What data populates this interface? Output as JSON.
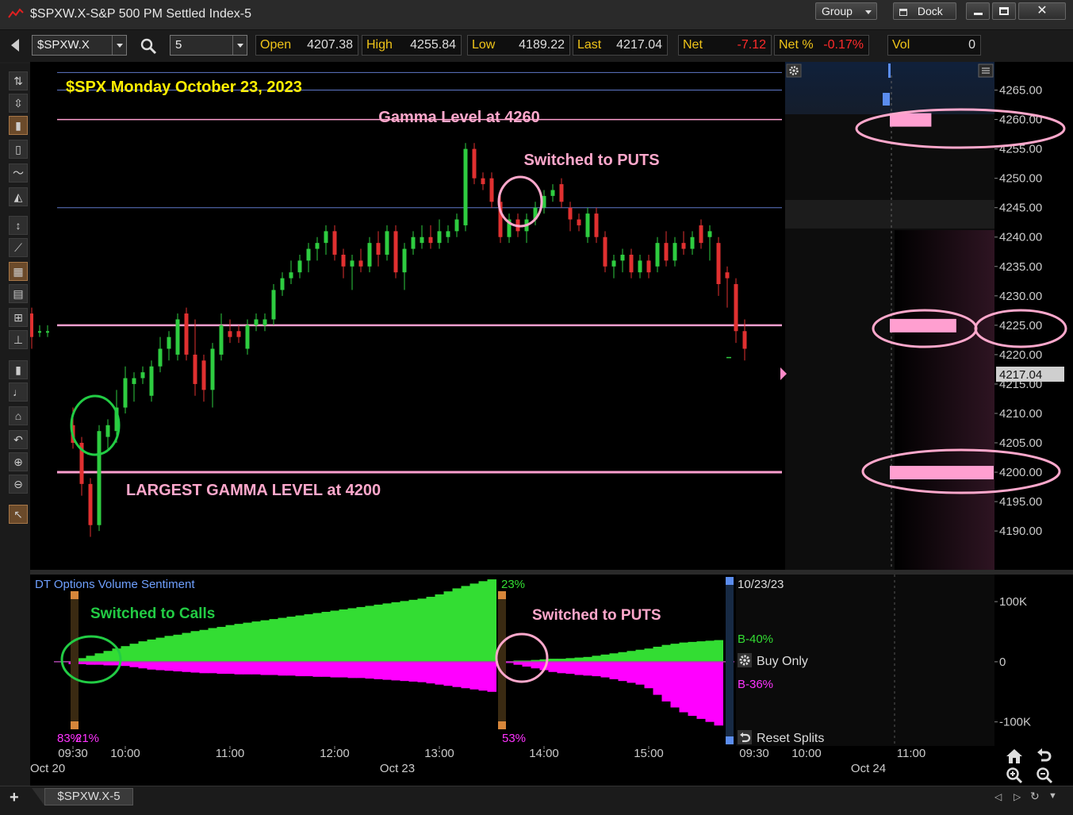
{
  "window": {
    "title": "$SPXW.X-S&P 500 PM Settled Index-5",
    "group_label": "Group",
    "dock_label": "Dock"
  },
  "toolbar": {
    "symbol": "$SPXW.X",
    "interval": "5",
    "quotes": [
      {
        "label": "Open",
        "value": "4207.38",
        "neg": false
      },
      {
        "label": "High",
        "value": "4255.84",
        "neg": false
      },
      {
        "label": "Low",
        "value": "4189.22",
        "neg": false
      },
      {
        "label": "Last",
        "value": "4217.04",
        "neg": false
      },
      {
        "label": "Net",
        "value": "-7.12",
        "neg": true
      },
      {
        "label": "Net %",
        "value": "-0.17%",
        "neg": true
      },
      {
        "label": "Vol",
        "value": "0",
        "neg": false
      }
    ]
  },
  "footer": {
    "tab_label": "$SPXW.X-5"
  },
  "colors": {
    "up": "#2ecc40",
    "down": "#e03030",
    "gamma": "#ff9fd0",
    "annotation_green": "#22cc44",
    "annotation_pink": "#ffa8cc",
    "title_yellow": "#ffee00",
    "calls": "#33dd33",
    "puts": "#ff00ff"
  },
  "chart_data": [
    {
      "type": "candlestick",
      "title": "$SPX Monday October 23, 2023",
      "y_ticks": [
        4190,
        4195,
        4200,
        4205,
        4210,
        4215,
        4220,
        4225,
        4230,
        4235,
        4240,
        4245,
        4250,
        4255,
        4260,
        4265
      ],
      "y_tick_labels": [
        "4190.00",
        "4195.00",
        "4200.00",
        "4205.00",
        "4210.00",
        "4215.00",
        "4220.00",
        "4225.00",
        "4230.00",
        "4235.00",
        "4240.00",
        "4245.00",
        "4250.00",
        "4255.00",
        "4260.00",
        "4265.00"
      ],
      "ylim": [
        4183.4,
        4269.8
      ],
      "x_ticks": [
        "09:30",
        "10:00",
        "11:00",
        "12:00",
        "13:00",
        "14:00",
        "15:00"
      ],
      "x_tick_times": [
        "09:30",
        "10:00",
        "11:00",
        "12:00",
        "13:00",
        "14:00",
        "15:00"
      ],
      "x_extra_labels": [
        "09:30",
        "10:00",
        "11:00"
      ],
      "x_date_labels": [
        "Oct 20",
        "Oct 23",
        "Oct 24"
      ],
      "last_price_label": "4217.04",
      "gamma_levels": [
        {
          "level": 4260,
          "label": "Gamma Level at 4260"
        },
        {
          "level": 4225,
          "label": ""
        },
        {
          "level": 4200,
          "label": "LARGEST GAMMA LEVEL at 4200"
        }
      ],
      "reference_lines": [
        4268,
        4265,
        4245
      ],
      "annotations": [
        "Switched to PUTS"
      ],
      "profile_bars": [
        {
          "level": 4260,
          "size": 0.4
        },
        {
          "level": 4225,
          "size": 0.64
        },
        {
          "level": 4200,
          "size": 1.0
        }
      ],
      "prior_day": [
        {
          "o": 4227,
          "h": 4228,
          "l": 4221,
          "c": 4223
        },
        {
          "o": 4224,
          "h": 4225,
          "l": 4223,
          "c": 4224
        },
        {
          "o": 4224,
          "h": 4225,
          "l": 4223,
          "c": 4224
        }
      ],
      "candles": [
        {
          "t": "09:30",
          "o": 4208,
          "h": 4211,
          "l": 4204,
          "c": 4205
        },
        {
          "t": "09:35",
          "o": 4205,
          "h": 4206,
          "l": 4196,
          "c": 4198
        },
        {
          "t": "09:40",
          "o": 4198,
          "h": 4199,
          "l": 4189,
          "c": 4191
        },
        {
          "t": "09:45",
          "o": 4191,
          "h": 4208,
          "l": 4190,
          "c": 4207
        },
        {
          "t": "09:50",
          "o": 4206,
          "h": 4209,
          "l": 4204,
          "c": 4208
        },
        {
          "t": "09:55",
          "o": 4207,
          "h": 4214,
          "l": 4205,
          "c": 4211
        },
        {
          "t": "10:00",
          "o": 4211,
          "h": 4218,
          "l": 4210,
          "c": 4216
        },
        {
          "t": "10:05",
          "o": 4215,
          "h": 4217,
          "l": 4212,
          "c": 4216
        },
        {
          "t": "10:10",
          "o": 4216,
          "h": 4218,
          "l": 4215,
          "c": 4217
        },
        {
          "t": "10:15",
          "o": 4213,
          "h": 4219,
          "l": 4212,
          "c": 4218
        },
        {
          "t": "10:20",
          "o": 4218,
          "h": 4223,
          "l": 4217,
          "c": 4221
        },
        {
          "t": "10:25",
          "o": 4221,
          "h": 4224,
          "l": 4219,
          "c": 4223
        },
        {
          "t": "10:30",
          "o": 4220,
          "h": 4227,
          "l": 4219,
          "c": 4226
        },
        {
          "t": "10:35",
          "o": 4227,
          "h": 4228,
          "l": 4219,
          "c": 4220
        },
        {
          "t": "10:40",
          "o": 4220,
          "h": 4226,
          "l": 4213,
          "c": 4215
        },
        {
          "t": "10:45",
          "o": 4219,
          "h": 4220,
          "l": 4212,
          "c": 4214
        },
        {
          "t": "10:50",
          "o": 4214,
          "h": 4222,
          "l": 4211,
          "c": 4221
        },
        {
          "t": "10:55",
          "o": 4220,
          "h": 4227,
          "l": 4219,
          "c": 4225
        },
        {
          "t": "11:00",
          "o": 4224,
          "h": 4226,
          "l": 4222,
          "c": 4223
        },
        {
          "t": "11:05",
          "o": 4224,
          "h": 4225,
          "l": 4222,
          "c": 4223
        },
        {
          "t": "11:10",
          "o": 4221,
          "h": 4226,
          "l": 4220,
          "c": 4225
        },
        {
          "t": "11:15",
          "o": 4225,
          "h": 4227,
          "l": 4224,
          "c": 4226
        },
        {
          "t": "11:20",
          "o": 4225,
          "h": 4227,
          "l": 4224,
          "c": 4226
        },
        {
          "t": "11:25",
          "o": 4226,
          "h": 4232,
          "l": 4225,
          "c": 4231
        },
        {
          "t": "11:30",
          "o": 4231,
          "h": 4234,
          "l": 4230,
          "c": 4233
        },
        {
          "t": "11:35",
          "o": 4233,
          "h": 4236,
          "l": 4232,
          "c": 4234
        },
        {
          "t": "11:40",
          "o": 4234,
          "h": 4237,
          "l": 4233,
          "c": 4236
        },
        {
          "t": "11:45",
          "o": 4236,
          "h": 4239,
          "l": 4234,
          "c": 4238
        },
        {
          "t": "11:50",
          "o": 4238,
          "h": 4240,
          "l": 4236,
          "c": 4239
        },
        {
          "t": "11:55",
          "o": 4239,
          "h": 4242,
          "l": 4237,
          "c": 4241
        },
        {
          "t": "12:00",
          "o": 4241,
          "h": 4242,
          "l": 4236,
          "c": 4237
        },
        {
          "t": "12:05",
          "o": 4237,
          "h": 4238,
          "l": 4233,
          "c": 4235
        },
        {
          "t": "12:10",
          "o": 4235,
          "h": 4237,
          "l": 4231,
          "c": 4236
        },
        {
          "t": "12:15",
          "o": 4236,
          "h": 4238,
          "l": 4234,
          "c": 4235
        },
        {
          "t": "12:20",
          "o": 4235,
          "h": 4240,
          "l": 4234,
          "c": 4239
        },
        {
          "t": "12:25",
          "o": 4239,
          "h": 4241,
          "l": 4235,
          "c": 4237
        },
        {
          "t": "12:30",
          "o": 4237,
          "h": 4242,
          "l": 4236,
          "c": 4241
        },
        {
          "t": "12:35",
          "o": 4241,
          "h": 4242,
          "l": 4233,
          "c": 4234
        },
        {
          "t": "12:40",
          "o": 4234,
          "h": 4239,
          "l": 4231,
          "c": 4238
        },
        {
          "t": "12:45",
          "o": 4238,
          "h": 4241,
          "l": 4237,
          "c": 4240
        },
        {
          "t": "12:50",
          "o": 4239,
          "h": 4242,
          "l": 4238,
          "c": 4240
        },
        {
          "t": "12:55",
          "o": 4240,
          "h": 4242,
          "l": 4238,
          "c": 4239
        },
        {
          "t": "13:00",
          "o": 4239,
          "h": 4243,
          "l": 4238,
          "c": 4241
        },
        {
          "t": "13:05",
          "o": 4240,
          "h": 4242,
          "l": 4239,
          "c": 4241
        },
        {
          "t": "13:10",
          "o": 4241,
          "h": 4244,
          "l": 4240,
          "c": 4243
        },
        {
          "t": "13:15",
          "o": 4242,
          "h": 4256,
          "l": 4241,
          "c": 4255
        },
        {
          "t": "13:20",
          "o": 4255,
          "h": 4256,
          "l": 4249,
          "c": 4250
        },
        {
          "t": "13:25",
          "o": 4250,
          "h": 4251,
          "l": 4248,
          "c": 4249
        },
        {
          "t": "13:30",
          "o": 4250,
          "h": 4251,
          "l": 4245,
          "c": 4246
        },
        {
          "t": "13:35",
          "o": 4246,
          "h": 4247,
          "l": 4239,
          "c": 4240
        },
        {
          "t": "13:40",
          "o": 4240,
          "h": 4244,
          "l": 4239,
          "c": 4243
        },
        {
          "t": "13:45",
          "o": 4243,
          "h": 4244,
          "l": 4240,
          "c": 4241
        },
        {
          "t": "13:50",
          "o": 4241,
          "h": 4244,
          "l": 4239,
          "c": 4243
        },
        {
          "t": "13:55",
          "o": 4243,
          "h": 4246,
          "l": 4242,
          "c": 4245
        },
        {
          "t": "14:00",
          "o": 4245,
          "h": 4248,
          "l": 4244,
          "c": 4247
        },
        {
          "t": "14:05",
          "o": 4247,
          "h": 4249,
          "l": 4246,
          "c": 4248
        },
        {
          "t": "14:10",
          "o": 4249,
          "h": 4250,
          "l": 4245,
          "c": 4246
        },
        {
          "t": "14:15",
          "o": 4245,
          "h": 4246,
          "l": 4241,
          "c": 4243
        },
        {
          "t": "14:20",
          "o": 4243,
          "h": 4244,
          "l": 4241,
          "c": 4242
        },
        {
          "t": "14:25",
          "o": 4240,
          "h": 4245,
          "l": 4239,
          "c": 4244
        },
        {
          "t": "14:30",
          "o": 4244,
          "h": 4245,
          "l": 4239,
          "c": 4240
        },
        {
          "t": "14:35",
          "o": 4240,
          "h": 4241,
          "l": 4234,
          "c": 4235
        },
        {
          "t": "14:40",
          "o": 4235,
          "h": 4237,
          "l": 4233,
          "c": 4236
        },
        {
          "t": "14:45",
          "o": 4236,
          "h": 4238,
          "l": 4234,
          "c": 4237
        },
        {
          "t": "14:50",
          "o": 4237,
          "h": 4238,
          "l": 4233,
          "c": 4234
        },
        {
          "t": "14:55",
          "o": 4234,
          "h": 4237,
          "l": 4233,
          "c": 4236
        },
        {
          "t": "15:00",
          "o": 4236,
          "h": 4237,
          "l": 4233,
          "c": 4234
        },
        {
          "t": "15:05",
          "o": 4235,
          "h": 4240,
          "l": 4234,
          "c": 4239
        },
        {
          "t": "15:10",
          "o": 4239,
          "h": 4241,
          "l": 4235,
          "c": 4236
        },
        {
          "t": "15:15",
          "o": 4236,
          "h": 4240,
          "l": 4235,
          "c": 4239
        },
        {
          "t": "15:20",
          "o": 4239,
          "h": 4241,
          "l": 4237,
          "c": 4238
        },
        {
          "t": "15:25",
          "o": 4238,
          "h": 4241,
          "l": 4237,
          "c": 4240
        },
        {
          "t": "15:30",
          "o": 4242,
          "h": 4243,
          "l": 4238,
          "c": 4239
        },
        {
          "t": "15:35",
          "o": 4240,
          "h": 4242,
          "l": 4236,
          "c": 4241
        },
        {
          "t": "15:40",
          "o": 4239,
          "h": 4240,
          "l": 4230,
          "c": 4232
        },
        {
          "t": "15:45",
          "o": 4234,
          "h": 4235,
          "l": 4228,
          "c": 4233
        },
        {
          "t": "15:50",
          "o": 4232,
          "h": 4233,
          "l": 4222,
          "c": 4224
        },
        {
          "t": "15:55",
          "o": 4224,
          "h": 4226,
          "l": 4219,
          "c": 4221
        }
      ]
    },
    {
      "type": "area",
      "title": "DT Options Volume Sentiment",
      "note": "calls (green, up) vs puts (magenta, down) cumulative volume",
      "y_tick_labels": [
        "100K",
        "0",
        "-100K"
      ],
      "y_ticks": [
        100,
        0,
        -100
      ],
      "ylim": [
        -140,
        145
      ],
      "x_ticks": [
        "09:30",
        "10:00",
        "11:00",
        "12:00",
        "13:00",
        "14:00",
        "15:00"
      ],
      "x_tick_times": [
        "09:30",
        "10:00",
        "11:00",
        "12:00",
        "13:00",
        "14:00",
        "15:00"
      ],
      "x_extra_labels": [
        "09:30",
        "10:00",
        "11:00"
      ],
      "x_date_labels": [
        "Oct 20",
        "Oct 23",
        "Oct 24"
      ],
      "date_label": "10/23/23",
      "labels": {
        "left_bottom_put": "83%",
        "left_bottom_call": "21%",
        "split_top": "23%",
        "split_bottom": "53%",
        "right_call": "B-40%",
        "right_put": "B-36%"
      },
      "buttons": {
        "buy_only": "Buy Only",
        "reset_splits": "Reset Splits"
      },
      "annotations": {
        "calls": "Switched to Calls",
        "puts": "Switched to PUTS"
      },
      "split_times": [
        "09:30",
        "13:35"
      ],
      "segment_1": {
        "start": "09:30",
        "step_minutes": 5,
        "calls_k": [
          0,
          6,
          10,
          14,
          18,
          22,
          26,
          30,
          34,
          37,
          40,
          43,
          45,
          48,
          51,
          53,
          56,
          58,
          61,
          63,
          65,
          67,
          69,
          71,
          73,
          75,
          77,
          79,
          81,
          83,
          85,
          87,
          89,
          91,
          93,
          95,
          97,
          99,
          101,
          103,
          105,
          108,
          112,
          117,
          122,
          126,
          130,
          134,
          137
        ],
        "puts_k": [
          -4,
          -4,
          -5,
          -5,
          -6,
          -6,
          -7,
          -9,
          -11,
          -13,
          -14,
          -15,
          -16,
          -17,
          -18,
          -19,
          -19,
          -20,
          -20,
          -21,
          -21,
          -21,
          -22,
          -22,
          -23,
          -23,
          -24,
          -24,
          -25,
          -25,
          -26,
          -26,
          -27,
          -27,
          -28,
          -29,
          -30,
          -31,
          -32,
          -33,
          -34,
          -36,
          -38,
          -40,
          -42,
          -44,
          -46,
          -48,
          -50
        ]
      },
      "segment_2": {
        "start": "13:40",
        "step_minutes": 5,
        "calls_k": [
          0,
          2,
          2,
          3,
          4,
          5,
          5,
          6,
          7,
          8,
          10,
          12,
          14,
          16,
          18,
          20,
          22,
          25,
          28,
          30,
          32,
          33,
          34,
          35,
          36
        ],
        "puts_k": [
          -2,
          -5,
          -8,
          -11,
          -14,
          -17,
          -19,
          -20,
          -22,
          -23,
          -24,
          -26,
          -29,
          -32,
          -35,
          -38,
          -44,
          -55,
          -66,
          -76,
          -84,
          -90,
          -95,
          -100,
          -106
        ]
      }
    }
  ]
}
